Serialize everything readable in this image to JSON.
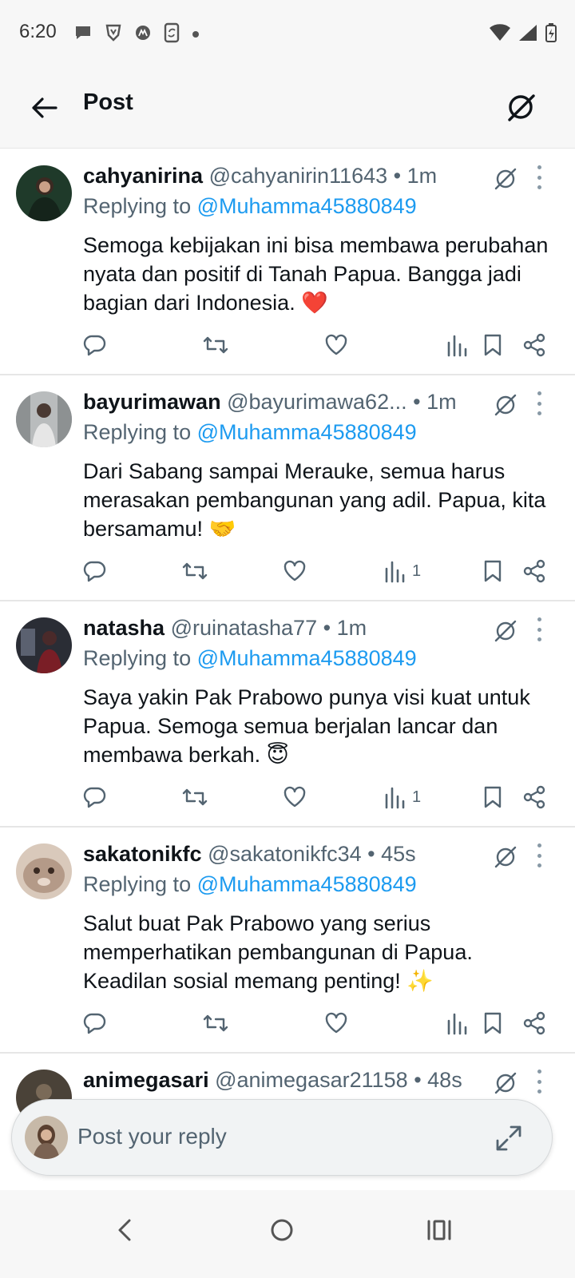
{
  "status": {
    "time": "6:20"
  },
  "header": {
    "title": "Post"
  },
  "tweets": [
    {
      "name": "cahyanirina",
      "handle": "@cahyanirin11643",
      "time": "• 1m",
      "reply_prefix": "Replying to",
      "reply_to": "@Muhamma45880849",
      "text": "Semoga kebijakan ini bisa membawa perubahan nyata dan positif di Tanah Papua. Bangga jadi bagian dari Indonesia. ❤️",
      "views": ""
    },
    {
      "name": "bayurimawan",
      "handle": "@bayurimawa62...",
      "time": "• 1m",
      "reply_prefix": "Replying to",
      "reply_to": "@Muhamma45880849",
      "text": "Dari Sabang sampai Merauke, semua harus merasakan pembangunan yang adil. Papua, kita bersamamu! 🤝",
      "views": "1"
    },
    {
      "name": "natasha",
      "handle": "@ruinatasha77",
      "time": "• 1m",
      "reply_prefix": "Replying to",
      "reply_to": "@Muhamma45880849",
      "text": "Saya yakin Pak Prabowo punya visi kuat untuk Papua. Semoga semua berjalan lancar dan membawa berkah. 😇",
      "views": "1"
    },
    {
      "name": "sakatonikfc",
      "handle": "@sakatonikfc34",
      "time": "• 45s",
      "reply_prefix": "Replying to",
      "reply_to": "@Muhamma45880849",
      "text": "Salut buat Pak Prabowo yang serius memperhatikan pembangunan di Papua. Keadilan sosial memang penting! ✨",
      "views": ""
    },
    {
      "name": "animegasari",
      "handle": "@animegasar21158",
      "time": "• 48s",
      "reply_prefix": "",
      "reply_to": "",
      "text": "",
      "views": ""
    }
  ],
  "reply_bar": {
    "placeholder": "Post your reply"
  },
  "colors": {
    "link": "#1d9bf0",
    "muted": "#536471",
    "text": "#0f1419"
  }
}
